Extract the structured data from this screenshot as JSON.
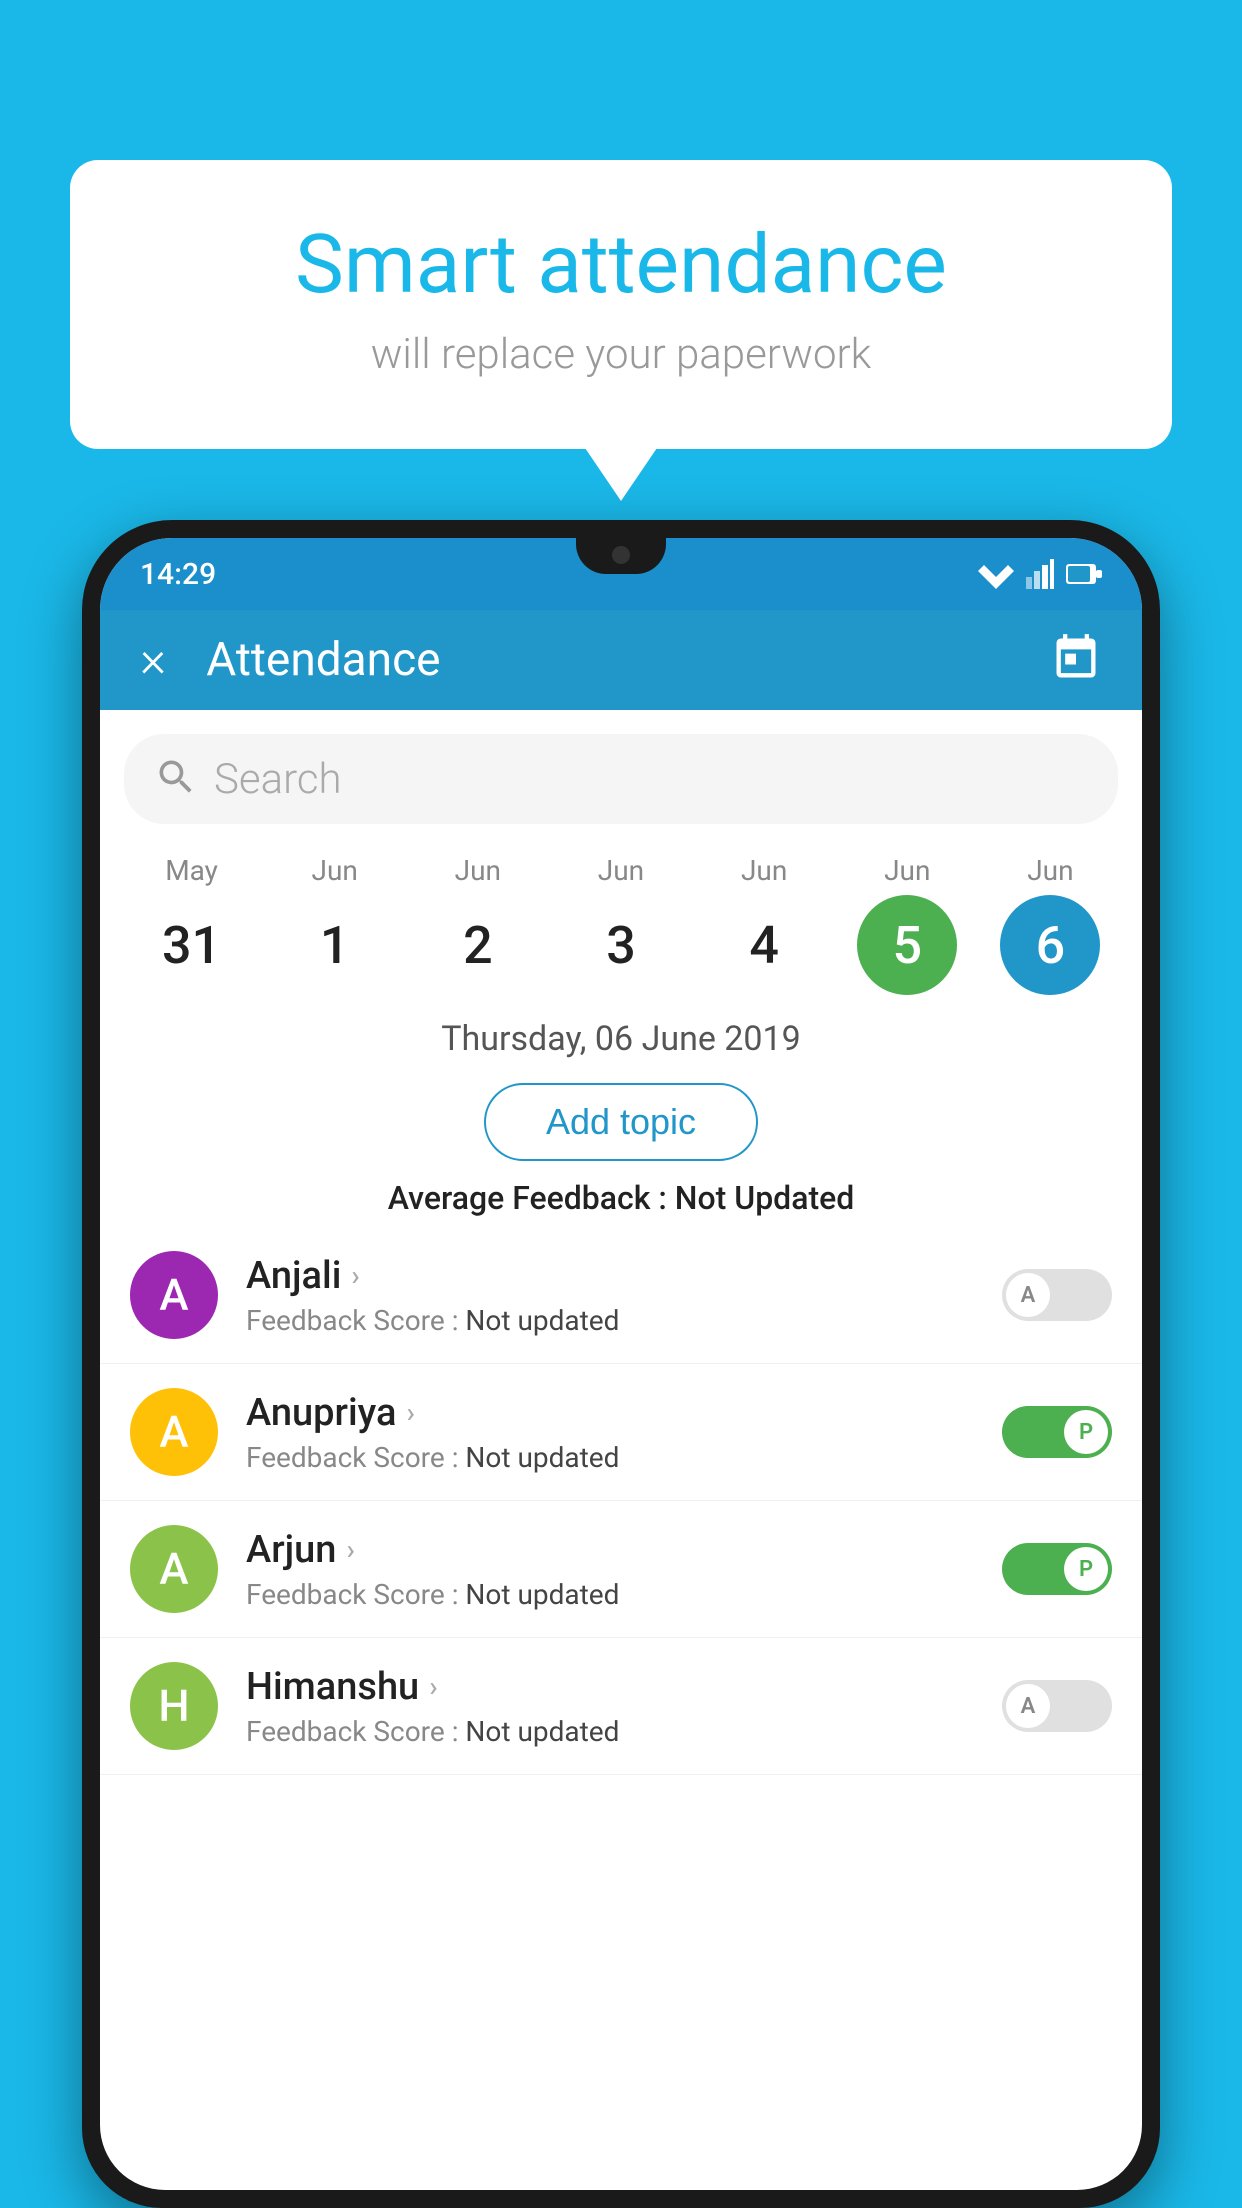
{
  "background_color": "#1ab8e8",
  "speech_bubble": {
    "title": "Smart attendance",
    "subtitle": "will replace your paperwork"
  },
  "status_bar": {
    "time": "14:29"
  },
  "app_header": {
    "title": "Attendance",
    "close_label": "×"
  },
  "search": {
    "placeholder": "Search"
  },
  "calendar": {
    "days": [
      {
        "month": "May",
        "date": "31",
        "state": "normal"
      },
      {
        "month": "Jun",
        "date": "1",
        "state": "normal"
      },
      {
        "month": "Jun",
        "date": "2",
        "state": "normal"
      },
      {
        "month": "Jun",
        "date": "3",
        "state": "normal"
      },
      {
        "month": "Jun",
        "date": "4",
        "state": "normal"
      },
      {
        "month": "Jun",
        "date": "5",
        "state": "active-green"
      },
      {
        "month": "Jun",
        "date": "6",
        "state": "active-blue"
      }
    ],
    "selected_date": "Thursday, 06 June 2019"
  },
  "add_topic_label": "Add topic",
  "avg_feedback_label": "Average Feedback : ",
  "avg_feedback_value": "Not Updated",
  "students": [
    {
      "name": "Anjali",
      "initial": "A",
      "avatar_color": "#9c27b0",
      "feedback_label": "Feedback Score : ",
      "feedback_value": "Not updated",
      "toggle": "off",
      "toggle_letter": "A"
    },
    {
      "name": "Anupriya",
      "initial": "A",
      "avatar_color": "#ffc107",
      "feedback_label": "Feedback Score : ",
      "feedback_value": "Not updated",
      "toggle": "on-green",
      "toggle_letter": "P"
    },
    {
      "name": "Arjun",
      "initial": "A",
      "avatar_color": "#8bc34a",
      "feedback_label": "Feedback Score : ",
      "feedback_value": "Not updated",
      "toggle": "on-green",
      "toggle_letter": "P"
    },
    {
      "name": "Himanshu",
      "initial": "H",
      "avatar_color": "#8bc34a",
      "feedback_label": "Feedback Score : ",
      "feedback_value": "Not updated",
      "toggle": "off",
      "toggle_letter": "A"
    }
  ]
}
